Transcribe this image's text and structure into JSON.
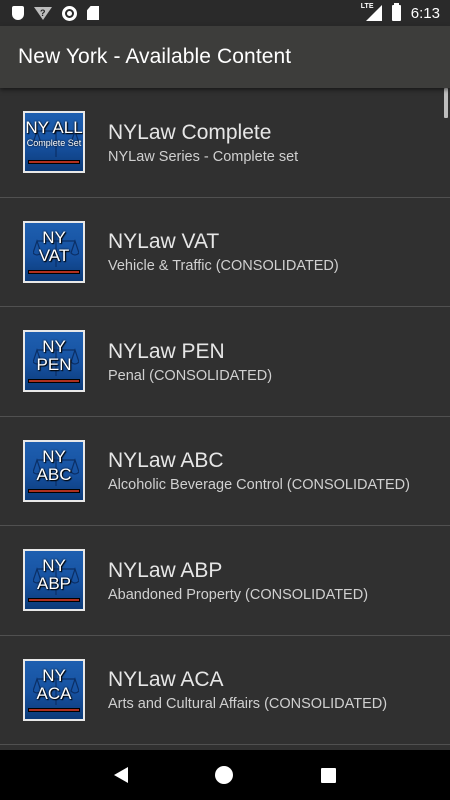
{
  "status_bar": {
    "time": "6:13",
    "network_label": "LTE",
    "icons": [
      "shield-icon",
      "wifi-unknown-icon",
      "circle-icon",
      "sd-card-icon",
      "lte-signal-icon",
      "battery-icon"
    ]
  },
  "app_bar": {
    "title": "New York - Available Content"
  },
  "list": {
    "items": [
      {
        "title": "NYLaw Complete",
        "subtitle": "NYLaw Series - Complete set",
        "thumb_code": "NY ALL",
        "thumb_sub": "Complete Set"
      },
      {
        "title": "NYLaw VAT",
        "subtitle": "Vehicle & Traffic (CONSOLIDATED)",
        "thumb_code": "NY",
        "thumb_sub": "VAT"
      },
      {
        "title": "NYLaw PEN",
        "subtitle": "Penal (CONSOLIDATED)",
        "thumb_code": "NY",
        "thumb_sub": "PEN"
      },
      {
        "title": "NYLaw ABC",
        "subtitle": "Alcoholic Beverage Control (CONSOLIDATED)",
        "thumb_code": "NY",
        "thumb_sub": "ABC"
      },
      {
        "title": "NYLaw ABP",
        "subtitle": "Abandoned Property (CONSOLIDATED)",
        "thumb_code": "NY",
        "thumb_sub": "ABP"
      },
      {
        "title": "NYLaw ACA",
        "subtitle": "Arts and Cultural Affairs (CONSOLIDATED)",
        "thumb_code": "NY",
        "thumb_sub": "ACA"
      }
    ]
  },
  "nav_bar": {
    "icons": [
      "back-icon",
      "home-icon",
      "recents-icon"
    ]
  },
  "colors": {
    "background": "#303030",
    "app_bar": "#3d3d3b",
    "thumb_blue": "#1e5fb0"
  }
}
